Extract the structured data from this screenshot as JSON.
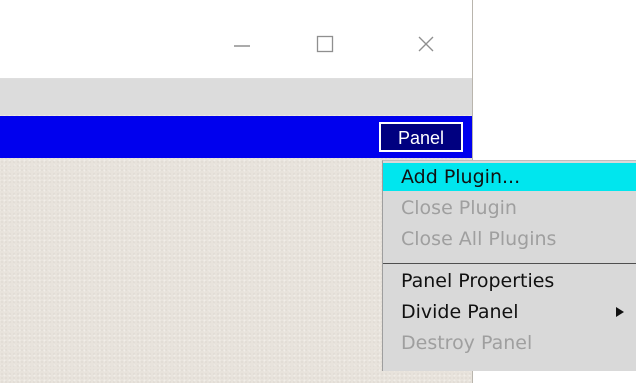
{
  "window": {
    "controls": {
      "minimize_icon": "minimize-icon",
      "maximize_icon": "maximize-icon",
      "close_icon": "close-icon"
    }
  },
  "panel": {
    "button_label": "Panel",
    "bar_color": "#0000ee"
  },
  "menu": {
    "items": [
      {
        "label": "Add Plugin...",
        "state": "highlighted"
      },
      {
        "label": "Close Plugin",
        "state": "disabled"
      },
      {
        "label": "Close All Plugins",
        "state": "disabled"
      },
      {
        "label": "Panel Properties",
        "state": "enabled"
      },
      {
        "label": "Divide Panel",
        "state": "enabled",
        "submenu": true
      },
      {
        "label": "Destroy Panel",
        "state": "disabled"
      }
    ],
    "highlight_color": "#00e6ee"
  }
}
